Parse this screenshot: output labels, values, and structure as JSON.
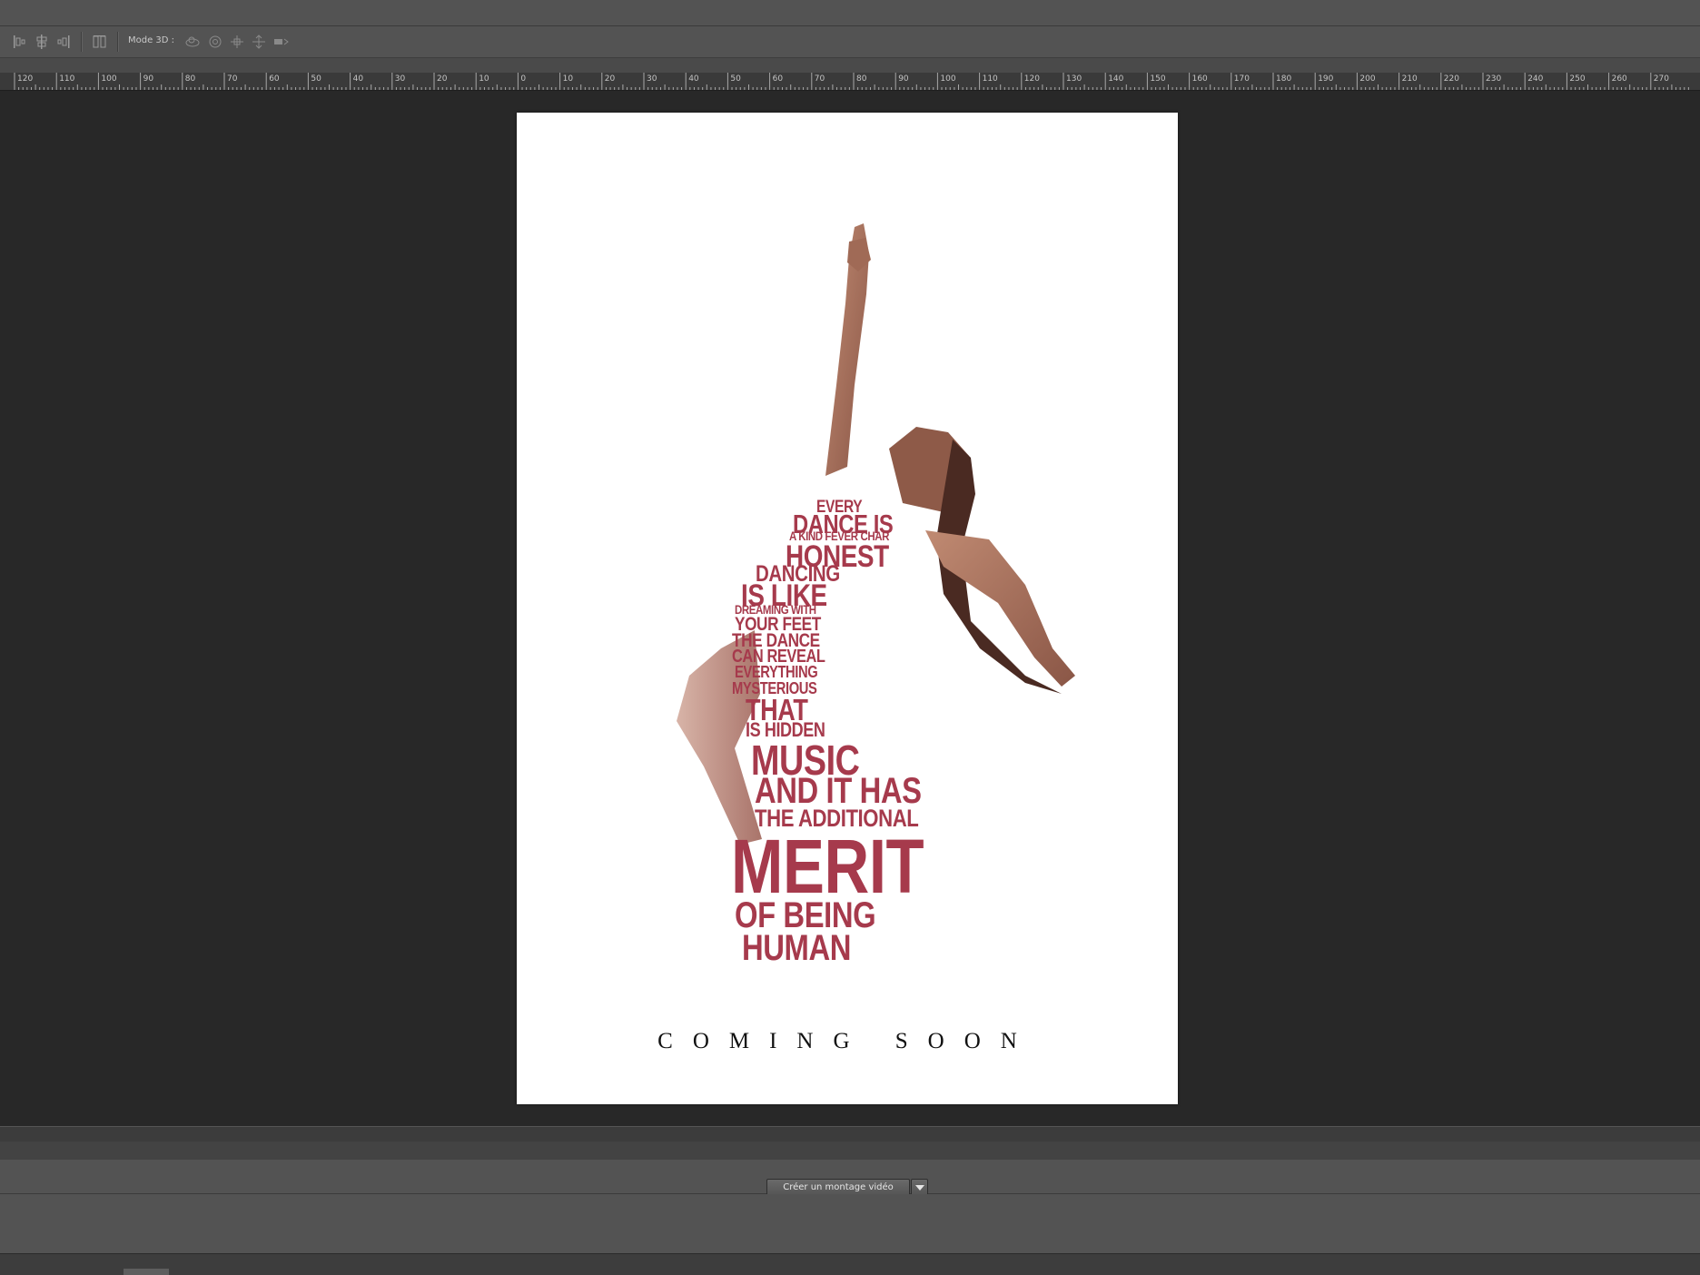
{
  "options_bar": {
    "mode3d_label": "Mode 3D :",
    "icons": [
      "distribute-left-icon",
      "distribute-hcenter-icon",
      "distribute-right-icon",
      "auto-align-icon",
      "orbit-3d-icon",
      "roll-3d-icon",
      "pan-3d-icon",
      "slide-3d-icon",
      "scale-3d-icon"
    ]
  },
  "ruler": {
    "labels": [
      "120",
      "110",
      "100",
      "90",
      "80",
      "70",
      "60",
      "50",
      "40",
      "30",
      "20",
      "10",
      "0",
      "10",
      "20",
      "30",
      "40",
      "50",
      "60",
      "70",
      "80",
      "90",
      "100",
      "110",
      "120",
      "130",
      "140",
      "150",
      "160",
      "170",
      "180",
      "190",
      "200",
      "210",
      "220",
      "230",
      "240",
      "250",
      "260",
      "270"
    ]
  },
  "poster": {
    "quote_lines": [
      "EVERY",
      "DANCE IS",
      "A KIND FEVER CHAR",
      "HONEST",
      "DANCING",
      "IS LIKE",
      "DREAMING WITH",
      "YOUR FEET",
      "THE DANCE",
      "CAN REVEAL",
      "EVERYTHING",
      "MYSTERIOUS",
      "THAT",
      "IS HIDDEN",
      "MUSIC",
      "AND IT HAS",
      "THE ADDITIONAL",
      "MERIT",
      "OF BEING",
      "HUMAN"
    ],
    "coming_soon": "COMING SOON",
    "accent_color": "#a63a4c",
    "skin_color": "#b07a64"
  },
  "timeline": {
    "create_video_label": "Créer un montage vidéo"
  }
}
